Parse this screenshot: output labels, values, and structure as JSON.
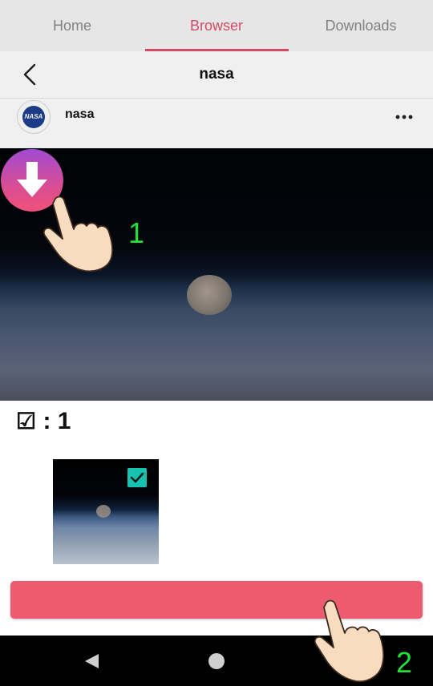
{
  "tabs": [
    {
      "label": "Home"
    },
    {
      "label": "Browser"
    },
    {
      "label": "Downloads"
    }
  ],
  "active_tab": "Browser",
  "title_bar": {
    "title": "nasa",
    "back_icon": "chevron-left-icon"
  },
  "post": {
    "username": "nasa",
    "avatar_text": "NASA",
    "more_icon": "more-horizontal-icon"
  },
  "download_fab": {
    "icon": "arrow-down-icon"
  },
  "tutorial": {
    "step1": "1",
    "step2": "2",
    "hand_icon": "pointing-hand-icon"
  },
  "selection": {
    "checkbox_glyph": "☑",
    "count_text": ": 1"
  },
  "thumbnail": {
    "checked": true
  },
  "download_button": {
    "label": ""
  },
  "navbar": {
    "back_icon": "nav-back-icon",
    "home_icon": "nav-home-icon"
  },
  "colors": {
    "accent": "#e0506b",
    "button": "#ec5b70",
    "check": "#16c3b0",
    "step_number": "#22e03a"
  }
}
